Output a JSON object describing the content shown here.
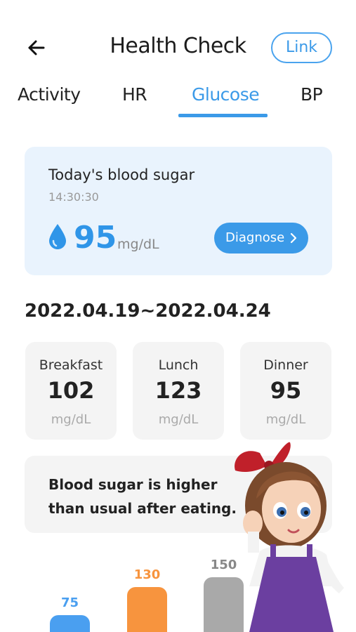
{
  "header": {
    "title": "Health Check",
    "link_label": "Link",
    "back_icon": "arrow-left-icon"
  },
  "tabs": [
    {
      "label": "Activity",
      "active": false
    },
    {
      "label": "HR",
      "active": false
    },
    {
      "label": "Glucose",
      "active": true
    },
    {
      "label": "BP",
      "active": false
    }
  ],
  "today": {
    "label": "Today's blood sugar",
    "time": "14:30:30",
    "value": "95",
    "unit": "mg/dL",
    "icon": "water-drop-icon",
    "diagnose_label": "Diagnose"
  },
  "date_range": "2022.04.19~2022.04.24",
  "meals": [
    {
      "name": "Breakfast",
      "value": "102",
      "unit": "mg/dL"
    },
    {
      "name": "Lunch",
      "value": "123",
      "unit": "mg/dL"
    },
    {
      "name": "Dinner",
      "value": "95",
      "unit": "mg/dL"
    }
  ],
  "message": "Blood sugar is higher than usual after eating.",
  "bars": [
    {
      "label": "75",
      "value": 75,
      "color": "#4a9ff0"
    },
    {
      "label": "130",
      "value": 130,
      "color": "#f7943e"
    },
    {
      "label": "150",
      "value": 150,
      "color": "#a9a9a9"
    }
  ],
  "colors": {
    "accent": "#3b9ae8",
    "card_blue": "#e9f3fd",
    "card_gray": "#f4f4f4"
  }
}
